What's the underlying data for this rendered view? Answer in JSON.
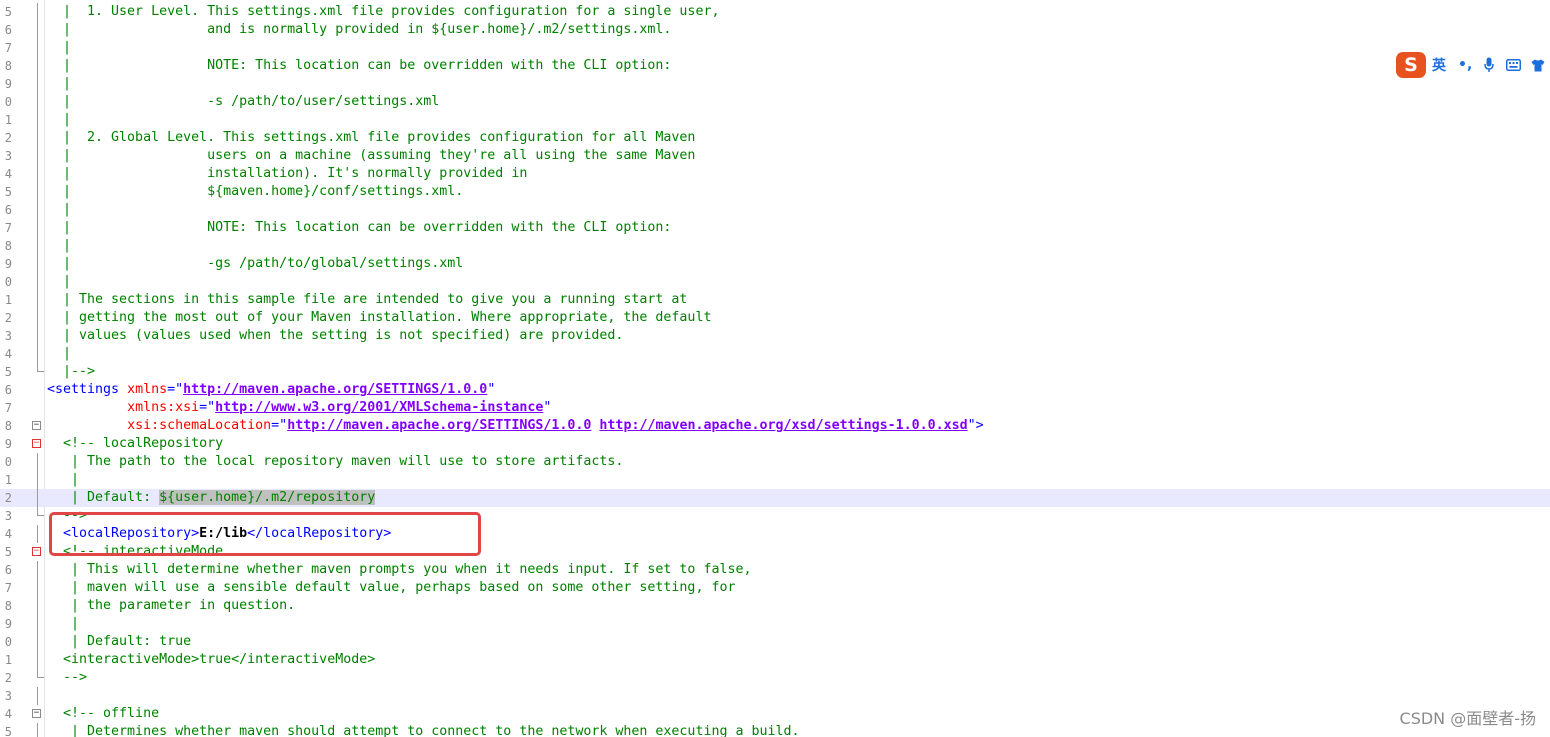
{
  "editor": {
    "lines": [
      {
        "ln": "5",
        "fold": "line",
        "hl": false,
        "segs": [
          [
            "c",
            "  |  1. User Level. This settings.xml file provides configuration for a single user,"
          ]
        ]
      },
      {
        "ln": "6",
        "fold": "line",
        "hl": false,
        "segs": [
          [
            "c",
            "  |                 and is normally provided in ${user.home}/.m2/settings.xml."
          ]
        ]
      },
      {
        "ln": "7",
        "fold": "line",
        "hl": false,
        "segs": [
          [
            "c",
            "  |"
          ]
        ]
      },
      {
        "ln": "8",
        "fold": "line",
        "hl": false,
        "segs": [
          [
            "c",
            "  |                 NOTE: This location can be overridden with the CLI option:"
          ]
        ]
      },
      {
        "ln": "9",
        "fold": "line",
        "hl": false,
        "segs": [
          [
            "c",
            "  |"
          ]
        ]
      },
      {
        "ln": "0",
        "fold": "line",
        "hl": false,
        "segs": [
          [
            "c",
            "  |                 -s /path/to/user/settings.xml"
          ]
        ]
      },
      {
        "ln": "1",
        "fold": "line",
        "hl": false,
        "segs": [
          [
            "c",
            "  |"
          ]
        ]
      },
      {
        "ln": "2",
        "fold": "line",
        "hl": false,
        "segs": [
          [
            "c",
            "  |  2. Global Level. This settings.xml file provides configuration for all Maven"
          ]
        ]
      },
      {
        "ln": "3",
        "fold": "line",
        "hl": false,
        "segs": [
          [
            "c",
            "  |                 users on a machine (assuming they're all using the same Maven"
          ]
        ]
      },
      {
        "ln": "4",
        "fold": "line",
        "hl": false,
        "segs": [
          [
            "c",
            "  |                 installation). It's normally provided in"
          ]
        ]
      },
      {
        "ln": "5",
        "fold": "line",
        "hl": false,
        "segs": [
          [
            "c",
            "  |                 ${maven.home}/conf/settings.xml."
          ]
        ]
      },
      {
        "ln": "6",
        "fold": "line",
        "hl": false,
        "segs": [
          [
            "c",
            "  |"
          ]
        ]
      },
      {
        "ln": "7",
        "fold": "line",
        "hl": false,
        "segs": [
          [
            "c",
            "  |                 NOTE: This location can be overridden with the CLI option:"
          ]
        ]
      },
      {
        "ln": "8",
        "fold": "line",
        "hl": false,
        "segs": [
          [
            "c",
            "  |"
          ]
        ]
      },
      {
        "ln": "9",
        "fold": "line",
        "hl": false,
        "segs": [
          [
            "c",
            "  |                 -gs /path/to/global/settings.xml"
          ]
        ]
      },
      {
        "ln": "0",
        "fold": "line",
        "hl": false,
        "segs": [
          [
            "c",
            "  |"
          ]
        ]
      },
      {
        "ln": "1",
        "fold": "line",
        "hl": false,
        "segs": [
          [
            "c",
            "  | The sections in this sample file are intended to give you a running start at"
          ]
        ]
      },
      {
        "ln": "2",
        "fold": "line",
        "hl": false,
        "segs": [
          [
            "c",
            "  | getting the most out of your Maven installation. Where appropriate, the default"
          ]
        ]
      },
      {
        "ln": "3",
        "fold": "line",
        "hl": false,
        "segs": [
          [
            "c",
            "  | values (values used when the setting is not specified) are provided."
          ]
        ]
      },
      {
        "ln": "4",
        "fold": "line",
        "hl": false,
        "segs": [
          [
            "c",
            "  |"
          ]
        ]
      },
      {
        "ln": "5",
        "fold": "end",
        "hl": false,
        "segs": [
          [
            "c",
            "  |-->"
          ]
        ]
      },
      {
        "ln": "6",
        "fold": "none",
        "hl": false,
        "segs": [
          [
            "t",
            "<settings "
          ],
          [
            "a",
            "xmlns"
          ],
          [
            "t",
            "=\""
          ],
          [
            "u",
            "http://maven.apache.org/SETTINGS/1.0.0"
          ],
          [
            "t",
            "\""
          ]
        ]
      },
      {
        "ln": "7",
        "fold": "none",
        "hl": false,
        "segs": [
          [
            "t",
            "          "
          ],
          [
            "a",
            "xmlns:xsi"
          ],
          [
            "t",
            "=\""
          ],
          [
            "u",
            "http://www.w3.org/2001/XMLSchema-instance"
          ],
          [
            "t",
            "\""
          ]
        ]
      },
      {
        "ln": "8",
        "fold": "box",
        "hl": false,
        "segs": [
          [
            "t",
            "          "
          ],
          [
            "a",
            "xsi:schemaLocation"
          ],
          [
            "t",
            "=\""
          ],
          [
            "u",
            "http://maven.apache.org/SETTINGS/1.0.0"
          ],
          [
            "t",
            " "
          ],
          [
            "u",
            "http://maven.apache.org/xsd/settings-1.0.0.xsd"
          ],
          [
            "t",
            "\">"
          ]
        ]
      },
      {
        "ln": "9",
        "fold": "boxred",
        "hl": false,
        "segs": [
          [
            "c",
            "  <!-- localRepository"
          ]
        ]
      },
      {
        "ln": "0",
        "fold": "line",
        "hl": false,
        "segs": [
          [
            "c",
            "   | The path to the local repository maven will use to store artifacts."
          ]
        ]
      },
      {
        "ln": "1",
        "fold": "line",
        "hl": false,
        "segs": [
          [
            "c",
            "   |"
          ]
        ]
      },
      {
        "ln": "2",
        "fold": "line",
        "hl": true,
        "segs": [
          [
            "c",
            "   | Default: "
          ],
          [
            "csel",
            "${user.home}/.m2/repository"
          ]
        ]
      },
      {
        "ln": "3",
        "fold": "end",
        "hl": false,
        "segs": [
          [
            "c",
            "  -->"
          ]
        ]
      },
      {
        "ln": "4",
        "fold": "line",
        "hl": false,
        "segs": [
          [
            "t",
            "  <localRepository>"
          ],
          [
            "b",
            "E:/lib"
          ],
          [
            "t",
            "</localRepository>"
          ]
        ]
      },
      {
        "ln": "5",
        "fold": "boxred",
        "hl": false,
        "segs": [
          [
            "c",
            "  <!-- interactiveMode"
          ]
        ]
      },
      {
        "ln": "6",
        "fold": "line",
        "hl": false,
        "segs": [
          [
            "c",
            "   | This will determine whether maven prompts you when it needs input. If set to false,"
          ]
        ]
      },
      {
        "ln": "7",
        "fold": "line",
        "hl": false,
        "segs": [
          [
            "c",
            "   | maven will use a sensible default value, perhaps based on some other setting, for"
          ]
        ]
      },
      {
        "ln": "8",
        "fold": "line",
        "hl": false,
        "segs": [
          [
            "c",
            "   | the parameter in question."
          ]
        ]
      },
      {
        "ln": "9",
        "fold": "line",
        "hl": false,
        "segs": [
          [
            "c",
            "   |"
          ]
        ]
      },
      {
        "ln": "0",
        "fold": "line",
        "hl": false,
        "segs": [
          [
            "c",
            "   | Default: true"
          ]
        ]
      },
      {
        "ln": "1",
        "fold": "line",
        "hl": false,
        "segs": [
          [
            "c",
            "  <interactiveMode>true</interactiveMode>"
          ]
        ]
      },
      {
        "ln": "2",
        "fold": "end",
        "hl": false,
        "segs": [
          [
            "c",
            "  -->"
          ]
        ]
      },
      {
        "ln": "3",
        "fold": "line",
        "hl": false,
        "segs": [
          [
            "c",
            ""
          ]
        ]
      },
      {
        "ln": "4",
        "fold": "box",
        "hl": false,
        "segs": [
          [
            "c",
            "  <!-- offline"
          ]
        ]
      },
      {
        "ln": "5",
        "fold": "line",
        "hl": false,
        "segs": [
          [
            "c",
            "   | Determines whether maven should attempt to connect to the network when executing a build."
          ]
        ]
      }
    ]
  },
  "ime": {
    "logo": "S",
    "lang": "英",
    "punct": "•,",
    "icons": [
      "microphone-icon",
      "keyboard-icon",
      "shirt-icon"
    ]
  },
  "watermark": "CSDN @面壁者-扬"
}
